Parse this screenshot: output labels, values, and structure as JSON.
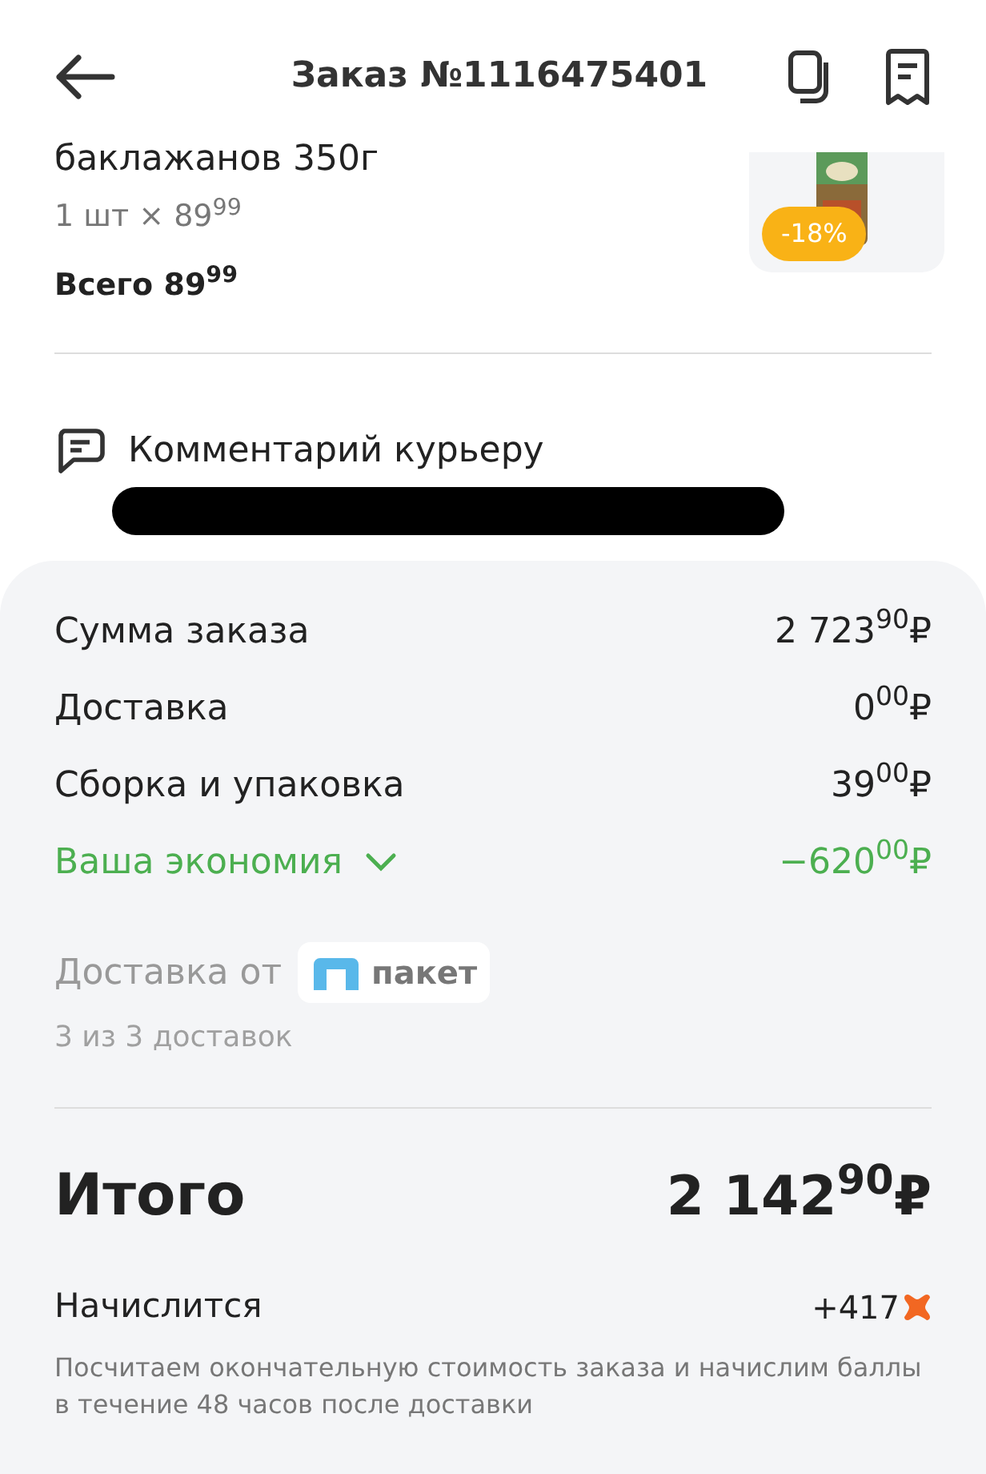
{
  "header": {
    "title": "Заказ №1116475401"
  },
  "product": {
    "name": "баклажанов 350г",
    "quantity": "1 шт × 89$^{99}$",
    "total": "Всего 89$^{99}$",
    "discount_badge": "-18%"
  },
  "comment": {
    "label": "Комментарий курьеру",
    "redacted": true
  },
  "summary": {
    "rows": [
      {
        "kind": "plain",
        "label": "Сумма заказа",
        "value": "2 723$^{90}$₽"
      },
      {
        "kind": "plain",
        "label": "Доставка",
        "value": "0$^{00}$₽"
      },
      {
        "kind": "plain",
        "label": "Сборка и упаковка",
        "value": "39$^{00}$₽"
      },
      {
        "kind": "savings",
        "label": "Ваша экономия",
        "value": "−620$^{00}$₽",
        "expanded": false
      }
    ],
    "delivery_by": {
      "label": "Доставка от",
      "brand": "пакет",
      "count": "3 из 3 доставок"
    },
    "total": {
      "label": "Итого",
      "value": "2 142$^{90}$₽"
    },
    "bonus": {
      "label": "Начислится",
      "value": "+417",
      "note": "Посчитаем окончательную стоимость заказа и начислим баллы в течение 48 часов после доставки"
    }
  }
}
